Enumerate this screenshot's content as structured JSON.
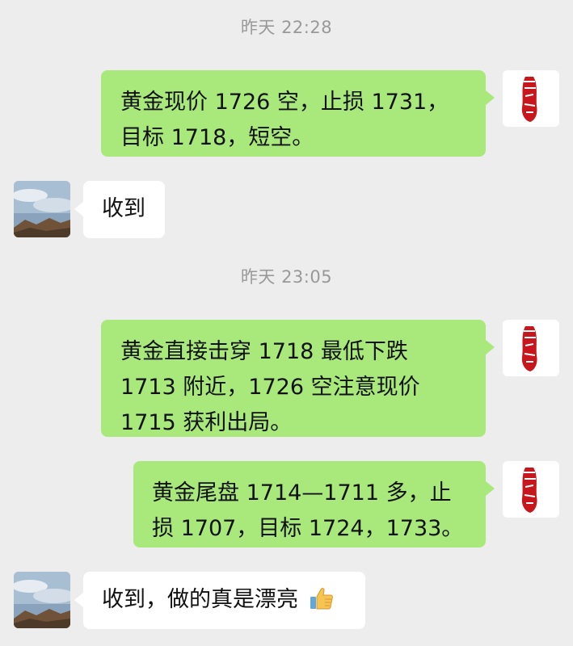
{
  "colors": {
    "background": "#ededed",
    "outgoing_bubble": "#a9e97b",
    "incoming_bubble": "#ffffff",
    "timestamp_text": "#999999",
    "seal_red": "#c8161d"
  },
  "timestamps": [
    "昨天 22:28",
    "昨天 23:05"
  ],
  "messages": [
    {
      "side": "outgoing",
      "avatar": "red-seal-avatar",
      "text": "黄金现价 1726 空，止损 1731，目标 1718，短空。"
    },
    {
      "side": "incoming",
      "avatar": "sky-landscape-avatar",
      "text": "收到"
    },
    {
      "side": "outgoing",
      "avatar": "red-seal-avatar",
      "text": "黄金直接击穿 1718 最低下跌 1713 附近，1726 空注意现价 1715 获利出局。"
    },
    {
      "side": "outgoing",
      "avatar": "red-seal-avatar",
      "text": "黄金尾盘 1714—1711 多，止损 1707，目标 1724，1733。"
    },
    {
      "side": "incoming",
      "avatar": "sky-landscape-avatar",
      "text": "收到，做的真是漂亮",
      "emoji": "thumbs-up"
    }
  ]
}
